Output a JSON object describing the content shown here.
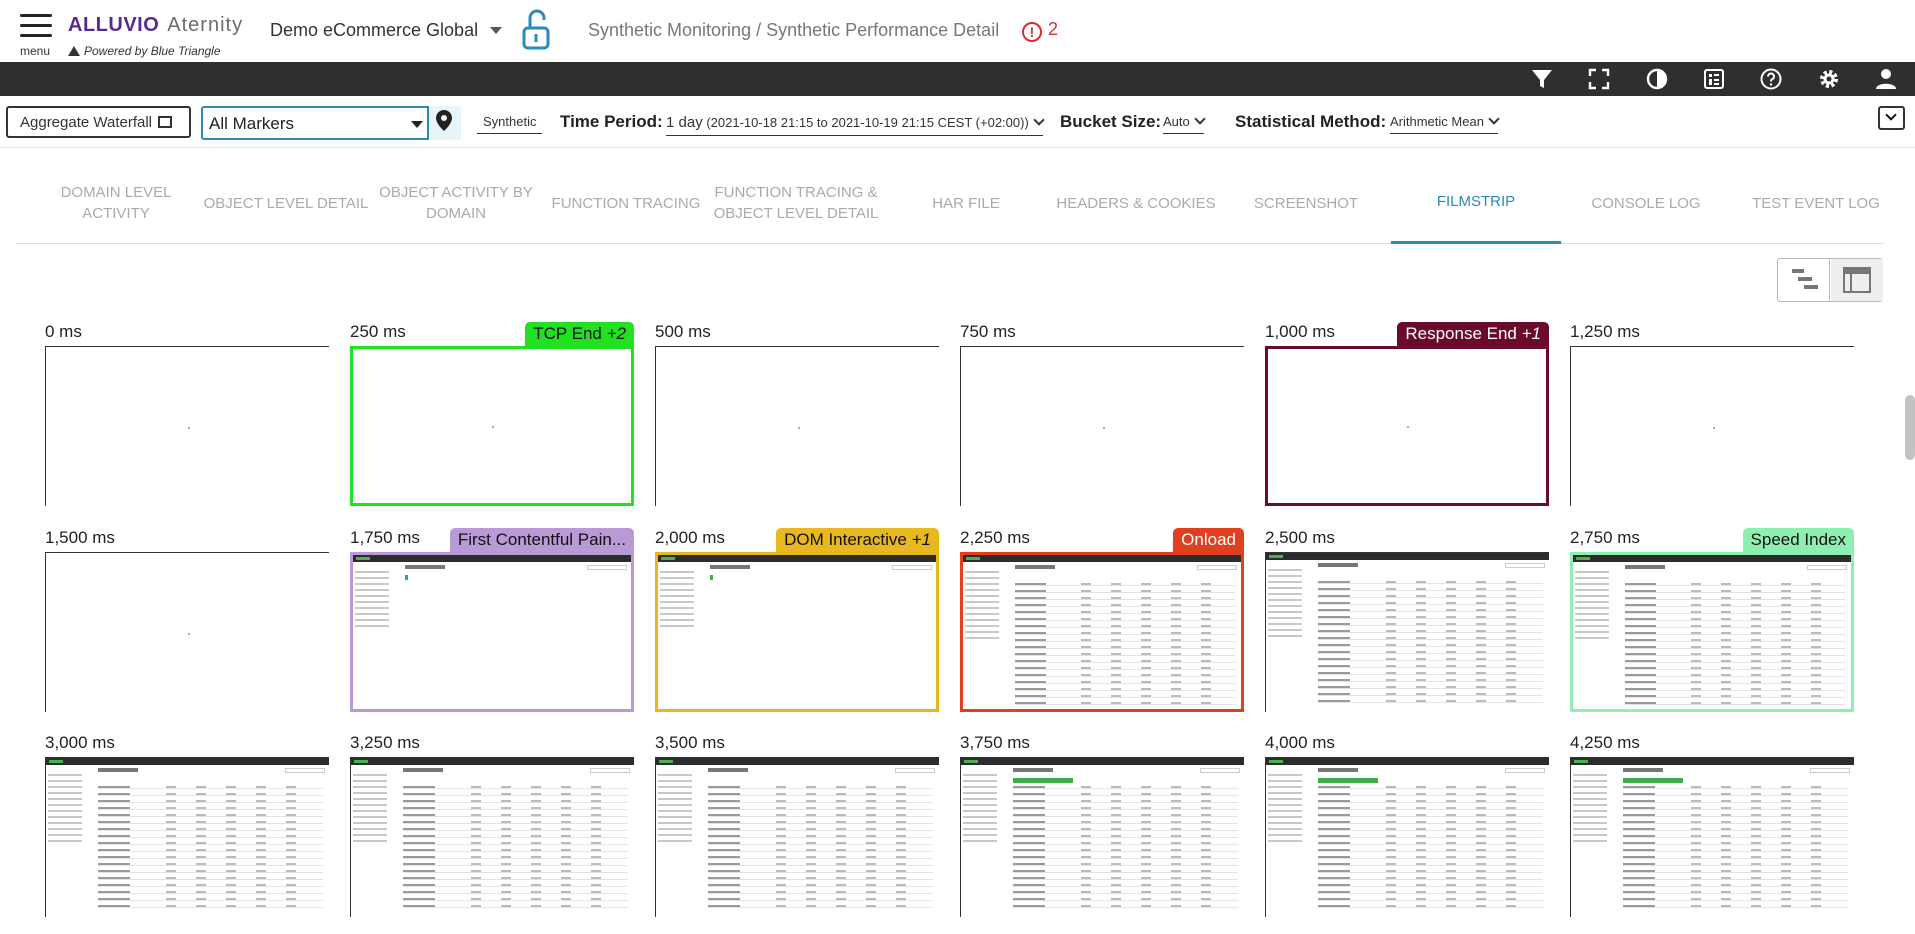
{
  "header": {
    "menu_label": "menu",
    "brand_primary": "ALLUVIO",
    "brand_secondary": "Aternity",
    "brand_sub": "Powered by Blue Triangle",
    "site": "Demo eCommerce Global",
    "breadcrumb": "Synthetic Monitoring / Synthetic Performance Detail",
    "alert_count": "2"
  },
  "toolbar": {
    "icons": [
      "filter-icon",
      "fullscreen-icon",
      "contrast-icon",
      "report-icon",
      "help-icon",
      "settings-icon",
      "user-icon"
    ]
  },
  "filters": {
    "aggregate_button": "Aggregate Waterfall",
    "markers_value": "All Markers",
    "synthetic_label": "Synthetic",
    "time_period_label": "Time Period:",
    "time_period_value": "1 day",
    "time_period_range": "(2021-10-18 21:15 to 2021-10-19 21:15 CEST (+02:00))",
    "bucket_label": "Bucket Size:",
    "bucket_value": "Auto",
    "stat_label": "Statistical Method:",
    "stat_value": "Arithmetic Mean"
  },
  "tabs": [
    {
      "label": "Domain Level Activity",
      "active": false
    },
    {
      "label": "Object Level Detail",
      "active": false
    },
    {
      "label": "Object Activity by Domain",
      "active": false
    },
    {
      "label": "Function Tracing",
      "active": false
    },
    {
      "label": "Function Tracing & Object Level Detail",
      "active": false
    },
    {
      "label": "HAR File",
      "active": false
    },
    {
      "label": "Headers & Cookies",
      "active": false
    },
    {
      "label": "Screenshot",
      "active": false
    },
    {
      "label": "Filmstrip",
      "active": true
    },
    {
      "label": "Console Log",
      "active": false
    },
    {
      "label": "Test Event Log",
      "active": false
    }
  ],
  "filmstrip": [
    {
      "time": "0 ms",
      "badge": "",
      "badge_extra": "",
      "color": "",
      "text_color": "",
      "content": "blank"
    },
    {
      "time": "250 ms",
      "badge": "TCP End",
      "badge_extra": "+2",
      "color": "#22e022",
      "text_color": "#111111",
      "content": "blank"
    },
    {
      "time": "500 ms",
      "badge": "",
      "badge_extra": "",
      "color": "",
      "text_color": "",
      "content": "blank"
    },
    {
      "time": "750 ms",
      "badge": "",
      "badge_extra": "",
      "color": "",
      "text_color": "",
      "content": "blank"
    },
    {
      "time": "1,000 ms",
      "badge": "Response End",
      "badge_extra": "+1",
      "color": "#6a0a2c",
      "text_color": "#ffffff",
      "content": "blank"
    },
    {
      "time": "1,250 ms",
      "badge": "",
      "badge_extra": "",
      "color": "",
      "text_color": "",
      "content": "blank"
    },
    {
      "time": "1,500 ms",
      "badge": "",
      "badge_extra": "",
      "color": "",
      "text_color": "",
      "content": "blank"
    },
    {
      "time": "1,750 ms",
      "badge": "First Contentful Pain...",
      "badge_extra": "",
      "color": "#b99ad6",
      "text_color": "#111111",
      "content": "skeleton"
    },
    {
      "time": "2,000 ms",
      "badge": "DOM Interactive",
      "badge_extra": "+1",
      "color": "#e8b820",
      "text_color": "#111111",
      "content": "skeleton"
    },
    {
      "time": "2,250 ms",
      "badge": "Onload",
      "badge_extra": "",
      "color": "#e04020",
      "text_color": "#ffffff",
      "content": "table"
    },
    {
      "time": "2,500 ms",
      "badge": "",
      "badge_extra": "",
      "color": "",
      "text_color": "",
      "content": "table"
    },
    {
      "time": "2,750 ms",
      "badge": "Speed Index",
      "badge_extra": "",
      "color": "#8ef0b0",
      "text_color": "#111111",
      "content": "table"
    },
    {
      "time": "3,000 ms",
      "badge": "",
      "badge_extra": "",
      "color": "",
      "text_color": "",
      "content": "table"
    },
    {
      "time": "3,250 ms",
      "badge": "",
      "badge_extra": "",
      "color": "",
      "text_color": "",
      "content": "table"
    },
    {
      "time": "3,500 ms",
      "badge": "",
      "badge_extra": "",
      "color": "",
      "text_color": "",
      "content": "table"
    },
    {
      "time": "3,750 ms",
      "badge": "",
      "badge_extra": "",
      "color": "",
      "text_color": "",
      "content": "table-progress"
    },
    {
      "time": "4,000 ms",
      "badge": "",
      "badge_extra": "",
      "color": "",
      "text_color": "",
      "content": "table-progress"
    },
    {
      "time": "4,250 ms",
      "badge": "",
      "badge_extra": "",
      "color": "",
      "text_color": "",
      "content": "table-progress"
    }
  ]
}
